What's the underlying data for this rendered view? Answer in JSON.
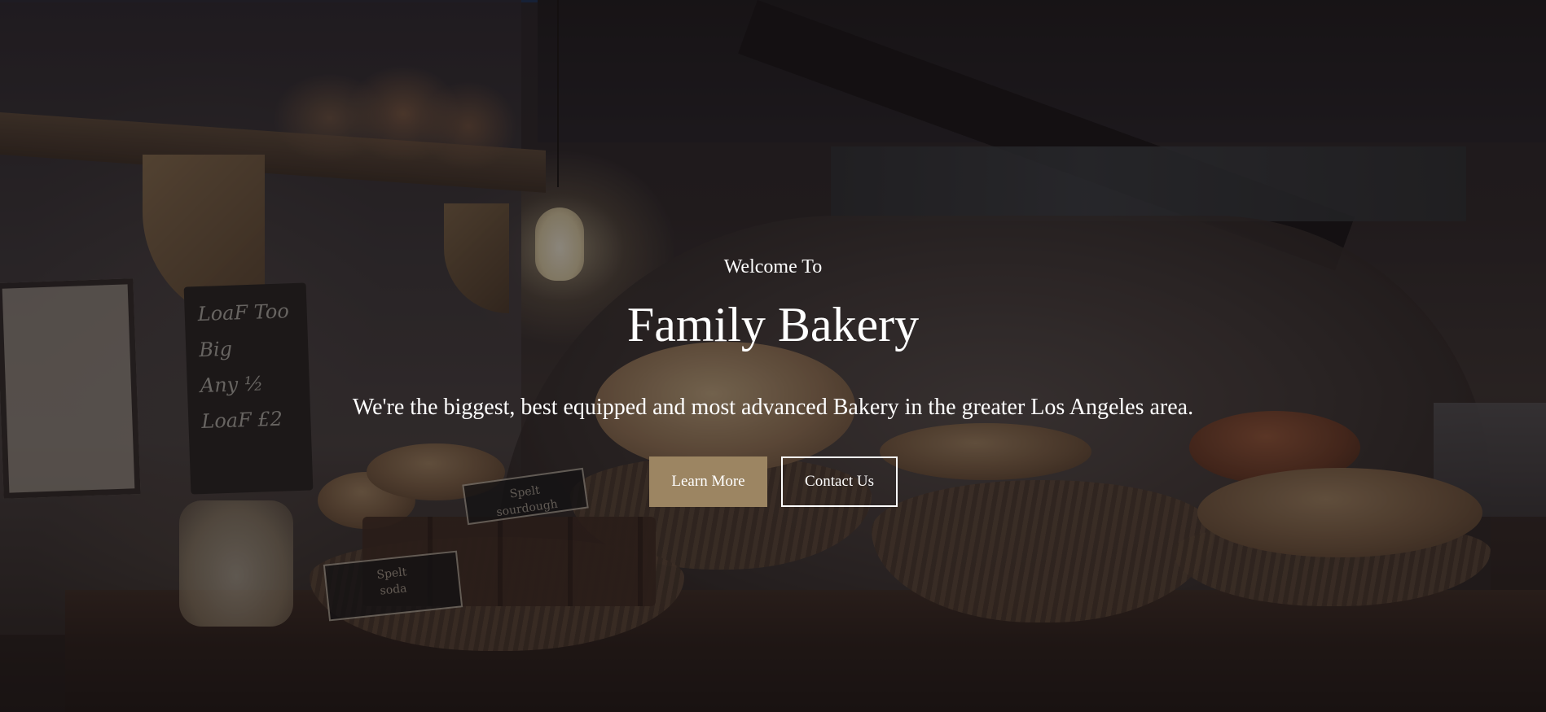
{
  "hero": {
    "welcome": "Welcome To",
    "title": "Family Bakery",
    "tagline": "We're the biggest, best equipped and most advanced Bakery in the greater Los Angeles area.",
    "primary_button_label": "Learn More",
    "secondary_button_label": "Contact Us"
  },
  "background": {
    "chalkboard_text": "LoaF Too\nBig\nAny ½\nLoaF £2",
    "sign_1_text": "Spelt\nsourdough",
    "sign_2_text": "Spelt\nsoda"
  },
  "colors": {
    "accent": "#9c8562",
    "text": "#ffffff",
    "top_border": "#17325a"
  }
}
